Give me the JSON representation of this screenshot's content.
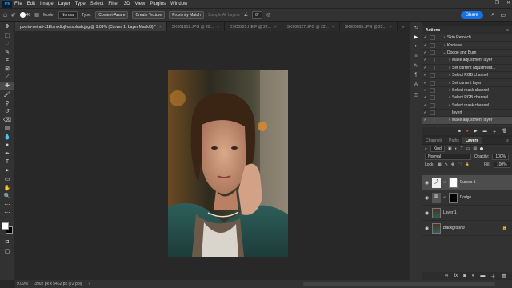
{
  "app": {
    "logo": "Ps"
  },
  "menu": [
    "File",
    "Edit",
    "Image",
    "Layer",
    "Type",
    "Select",
    "Filter",
    "3D",
    "View",
    "Plugins",
    "Window"
  ],
  "window_controls": [
    "—",
    "❐",
    "✕"
  ],
  "options_bar": {
    "brush_size": "40",
    "mode_label": "Mode:",
    "mode_value": "Normal",
    "type_label": "Type:",
    "content_aware": "Content-Aware",
    "create_texture": "Create Texture",
    "proximity_match": "Proximity Match",
    "sample_all": "Sample All Layers",
    "angle": "0°",
    "share": "Share"
  },
  "tabs": [
    {
      "label": "pooria-seirafi-J1Etsmkltojl-unsplash.jpg @ 9.09% (Curves 1, Layer Mask/8) *",
      "active": true
    },
    {
      "label": "SK901819.JPG @ 22...",
      "active": false
    },
    {
      "label": "DSC0925.HEIF @ 22...",
      "active": false
    },
    {
      "label": "SK900127.JPG @ 22...",
      "active": false
    },
    {
      "label": "SK900865.JPG @ 22...",
      "active": false
    }
  ],
  "status": {
    "zoom": "9.09%",
    "doc_size": "3902 px x 5462 px (72 ppi)"
  },
  "actions_panel": {
    "title": "Actions",
    "items": [
      {
        "label": "Skin Retouch",
        "indent": 1,
        "twirl": "›"
      },
      {
        "label": "Kodiake",
        "indent": 1,
        "twirl": "›"
      },
      {
        "label": "Dodge and Burn",
        "indent": 1,
        "twirl": "⌄"
      },
      {
        "label": "Make adjustment layer",
        "indent": 2,
        "twirl": "›"
      },
      {
        "label": "Set current adjustment...",
        "indent": 2,
        "twirl": "›"
      },
      {
        "label": "Select RGB channel",
        "indent": 2,
        "twirl": "›"
      },
      {
        "label": "Set current layer",
        "indent": 2,
        "twirl": "›"
      },
      {
        "label": "Select mask channel",
        "indent": 2,
        "twirl": "›"
      },
      {
        "label": "Select RGB channel",
        "indent": 2,
        "twirl": "›"
      },
      {
        "label": "Select mask channel",
        "indent": 2,
        "twirl": "›"
      },
      {
        "label": "Invert",
        "indent": 2,
        "twirl": ""
      },
      {
        "label": "Make adjustment layer",
        "indent": 2,
        "twirl": "›",
        "selected": true
      }
    ]
  },
  "layers_panel": {
    "tabs": [
      "Channels",
      "Paths",
      "Layers"
    ],
    "active_tab": "Layers",
    "kind_label": "Kind",
    "blend_mode": "Normal",
    "opacity_label": "Opacity:",
    "opacity": "100%",
    "lock_label": "Lock:",
    "fill_label": "Fill:",
    "fill": "100%",
    "layers": [
      {
        "name": "Curves 1",
        "kind": "adjustment",
        "selected": true
      },
      {
        "name": "Dodge",
        "kind": "mask"
      },
      {
        "name": "Layer 1",
        "kind": "photo"
      },
      {
        "name": "Background",
        "kind": "photo",
        "italic": true
      }
    ]
  },
  "colors": {
    "accent": "#1473e6",
    "panel": "#323232",
    "canvas": "#282828",
    "record": "#e34850"
  }
}
